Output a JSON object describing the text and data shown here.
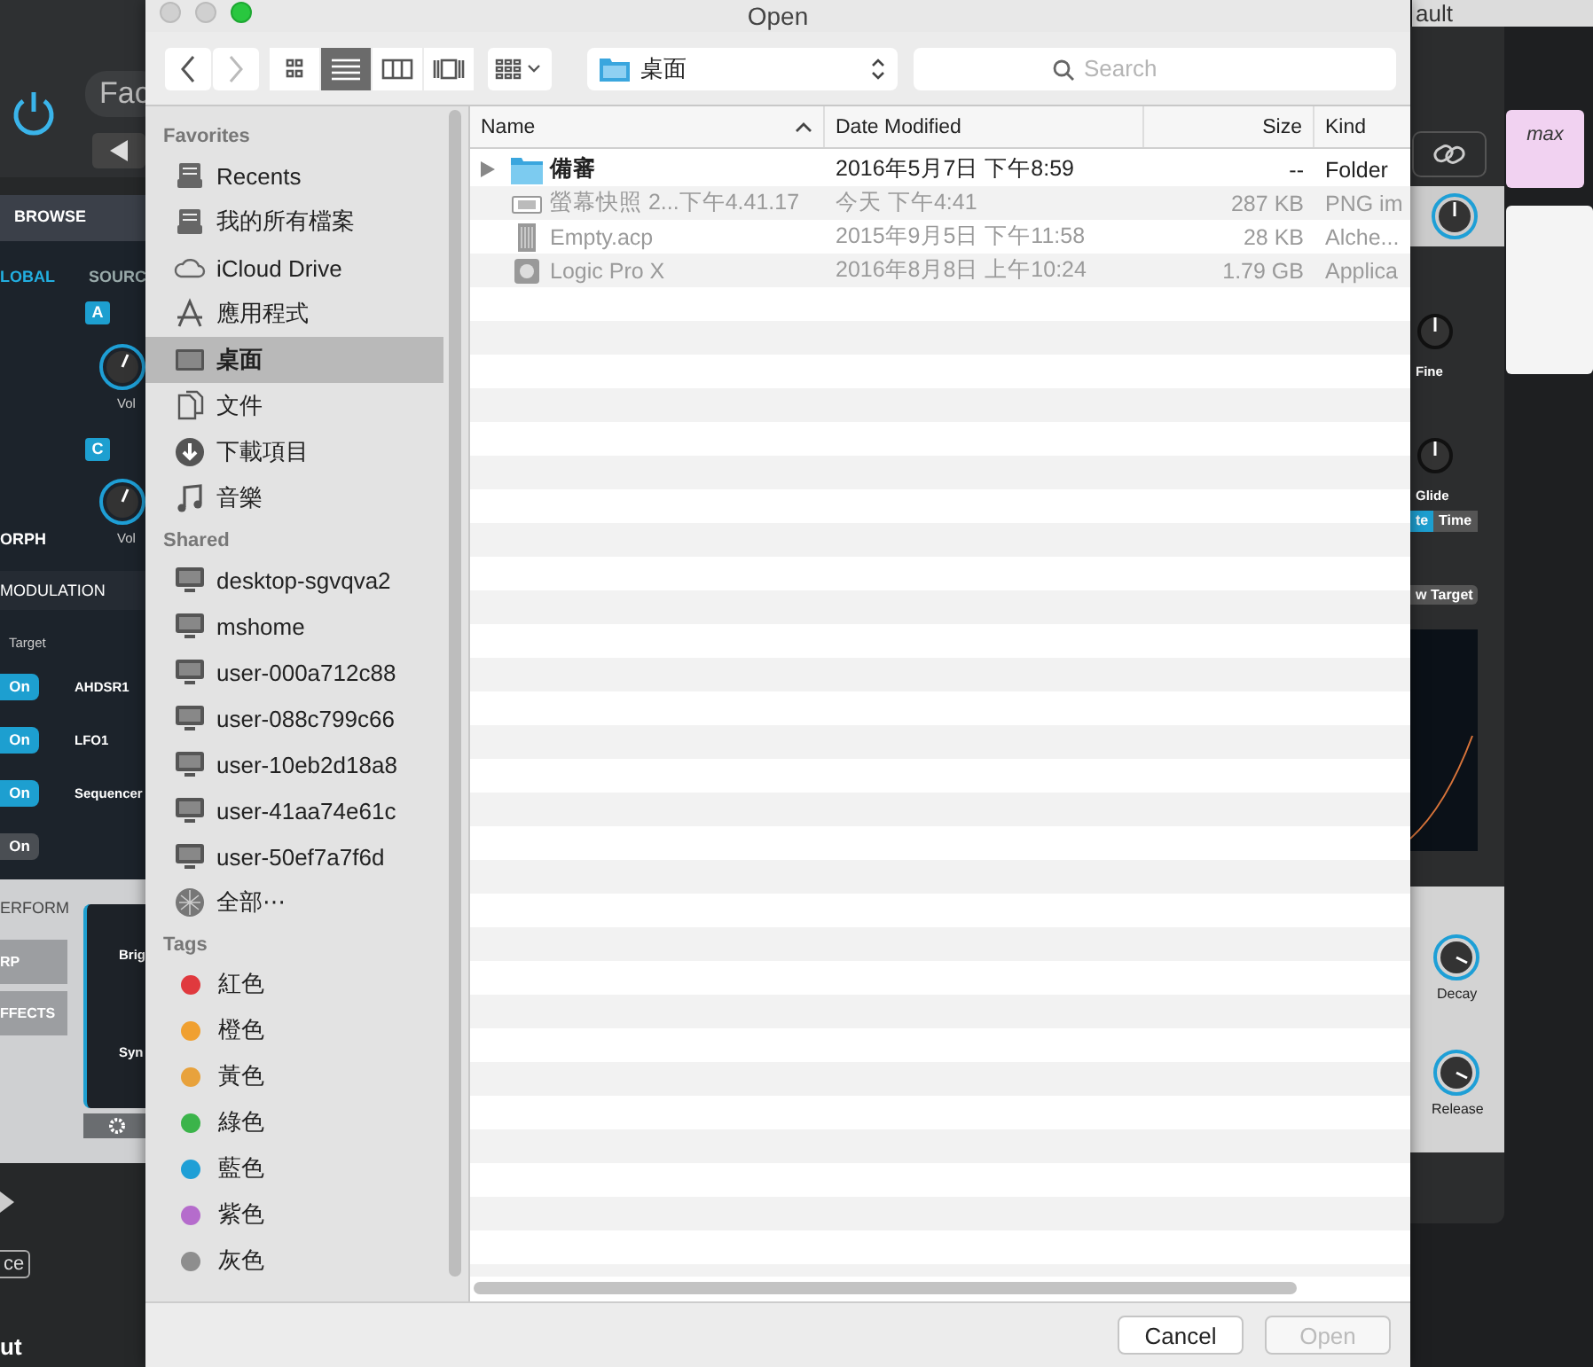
{
  "background_app": {
    "title_fragment": "ault",
    "preset_fragment": "Fac",
    "tab": "BROWSE",
    "global_label": "LOBAL",
    "source_label": "SOURC",
    "source_badges": [
      "A",
      "C"
    ],
    "left_knob_labels": [
      "Vol",
      "Vol"
    ],
    "morph_label": "ORPH",
    "modulation_label": "MODULATION",
    "target_header": "Target",
    "mod_rows": [
      {
        "label": "On",
        "on": true,
        "source": "AHDSR1"
      },
      {
        "label": "On",
        "on": true,
        "source": "LFO1"
      },
      {
        "label": "On",
        "on": true,
        "source": "Sequencer"
      },
      {
        "label": "On",
        "on": false
      }
    ],
    "perform_label": "ERFORM",
    "perform_items": [
      "RP",
      "FFECTS"
    ],
    "macro_labels": [
      "Brig",
      "Syn"
    ],
    "bottom_fragments": [
      "ce",
      "ut"
    ],
    "key_label": "max",
    "right_knob_labels": [
      "Fine",
      "Glide"
    ],
    "mode_buttons": [
      {
        "label": "te",
        "selected": true
      },
      {
        "label": "Time",
        "selected": false
      }
    ],
    "target_button": "w Target",
    "envelope_knob_labels": [
      "Decay",
      "Release"
    ]
  },
  "window": {
    "title": "Open"
  },
  "toolbar": {
    "view_modes": [
      {
        "kind": "icons",
        "selected": false
      },
      {
        "kind": "list",
        "selected": true
      },
      {
        "kind": "columns",
        "selected": false
      },
      {
        "kind": "coverflow",
        "selected": false
      }
    ],
    "location": "桌面",
    "search": {
      "placeholder": "Search"
    }
  },
  "sidebar": {
    "sections": [
      {
        "title": "Favorites",
        "items": [
          {
            "label": "Recents",
            "kind": "stack",
            "selected": false
          },
          {
            "label": "我的所有檔案",
            "kind": "stack",
            "selected": false
          },
          {
            "label": "iCloud Drive",
            "kind": "cloud",
            "selected": false
          },
          {
            "label": "應用程式",
            "kind": "apps",
            "selected": false
          },
          {
            "label": "桌面",
            "kind": "desktop",
            "selected": true
          },
          {
            "label": "文件",
            "kind": "document",
            "selected": false
          },
          {
            "label": "下載項目",
            "kind": "download",
            "selected": false
          },
          {
            "label": "音樂",
            "kind": "music",
            "selected": false
          }
        ]
      },
      {
        "title": "Shared",
        "items": [
          {
            "label": "desktop-sgvqva2",
            "kind": "computer",
            "selected": false
          },
          {
            "label": "mshome",
            "kind": "computer",
            "selected": false
          },
          {
            "label": "user-000a712c88",
            "kind": "computer",
            "selected": false
          },
          {
            "label": "user-088c799c66",
            "kind": "computer",
            "selected": false
          },
          {
            "label": "user-10eb2d18a8",
            "kind": "computer",
            "selected": false
          },
          {
            "label": "user-41aa74e61c",
            "kind": "computer",
            "selected": false
          },
          {
            "label": "user-50ef7a7f6d",
            "kind": "computer",
            "selected": false
          },
          {
            "label": "全部⋯",
            "kind": "network",
            "selected": false
          }
        ]
      }
    ],
    "tags_title": "Tags",
    "tags": [
      {
        "label": "紅色",
        "color": "#e0393e"
      },
      {
        "label": "橙色",
        "color": "#f0a030"
      },
      {
        "label": "黃色",
        "color": "#e8a23c"
      },
      {
        "label": "綠色",
        "color": "#3bb44a"
      },
      {
        "label": "藍色",
        "color": "#1e9fd6"
      },
      {
        "label": "紫色",
        "color": "#b56ccc"
      },
      {
        "label": "灰色",
        "color": "#8e8e8e"
      }
    ]
  },
  "table": {
    "columns": [
      {
        "label": "Name",
        "sorted": true
      },
      {
        "label": "Date Modified",
        "sorted": false
      },
      {
        "label": "Size",
        "sorted": false
      },
      {
        "label": "Kind",
        "sorted": false
      }
    ],
    "rows": [
      {
        "kind": "folder",
        "expandable": true,
        "disabled": false,
        "name": "備審",
        "date": "2016年5月7日 下午8:59",
        "size": "--",
        "type": "Folder"
      },
      {
        "kind": "image",
        "expandable": false,
        "disabled": true,
        "name": "螢幕快照 2...下午4.41.17",
        "date": "今天 下午4:41",
        "size": "287 KB",
        "type": "PNG im"
      },
      {
        "kind": "document",
        "expandable": false,
        "disabled": true,
        "name": "Empty.acp",
        "date": "2015年9月5日 下午11:58",
        "size": "28 KB",
        "type": "Alche..."
      },
      {
        "kind": "app",
        "expandable": false,
        "disabled": true,
        "name": "Logic Pro X",
        "date": "2016年8月8日 上午10:24",
        "size": "1.79 GB",
        "type": "Applica"
      }
    ]
  },
  "buttons": [
    {
      "label": "Cancel",
      "disabled": false
    },
    {
      "label": "Open",
      "disabled": true
    }
  ]
}
